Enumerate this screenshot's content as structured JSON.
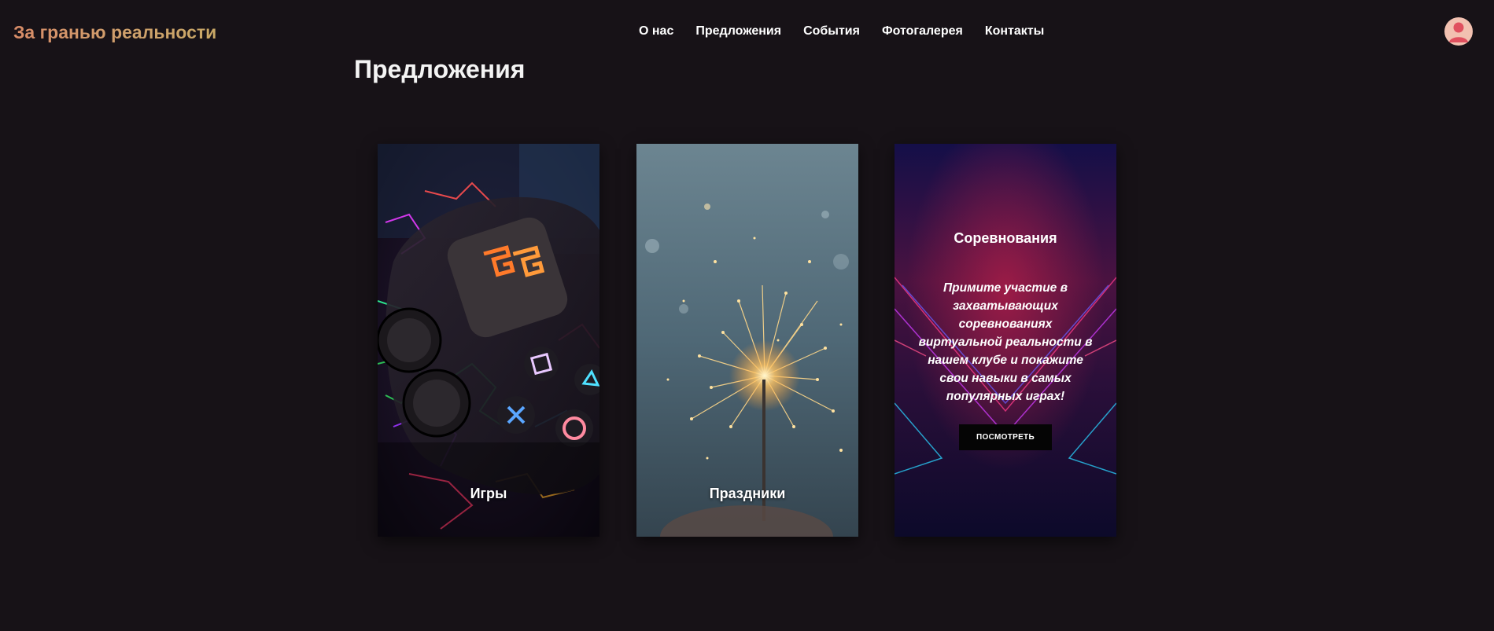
{
  "header": {
    "logo": "За гранью реальности",
    "nav": [
      "О нас",
      "Предложения",
      "События",
      "Фотогалерея",
      "Контакты"
    ],
    "avatar_icon": "user-icon"
  },
  "main": {
    "title": "Предложения",
    "cards": [
      {
        "label": "Игры",
        "image": "neon game controller"
      },
      {
        "label": "Праздники",
        "image": "sparkler"
      },
      {
        "title": "Соревнования",
        "description": "Примите участие в захватывающих соревнованиях виртуальной реальности в нашем клубе и покажите свои навыки в самых популярных играх!",
        "button": "ПОСМОТРЕТЬ",
        "image": "neon tunnel"
      }
    ]
  },
  "colors": {
    "background": "#171217",
    "logo_gradient_start": "#d98c68",
    "logo_gradient_end": "#c9a866",
    "button_bg": "#050505",
    "avatar_bg": "#f2c1b1",
    "avatar_fg": "#e0505f"
  }
}
